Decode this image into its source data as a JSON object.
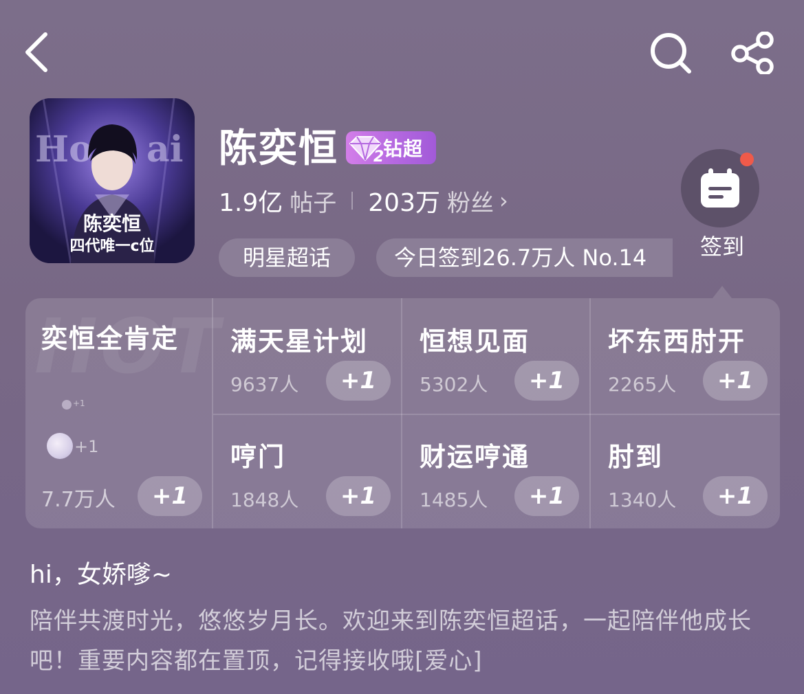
{
  "topbar": {
    "back_icon": "chevron-left-icon",
    "search_icon": "search-icon",
    "share_icon": "share-icon"
  },
  "profile": {
    "avatar_text_line1": "陈奕恒",
    "avatar_text_line2": "四代唯一c位",
    "name": "陈奕恒",
    "badge_text": "钻超",
    "badge_level": "2",
    "posts_num": "1.9亿",
    "posts_unit": "帖子",
    "fans_num": "203万",
    "fans_unit": "粉丝",
    "fans_chevron": "›",
    "tag_category": "明星超话",
    "tag_checkin": "今日签到26.7万人 No.14"
  },
  "checkin": {
    "label": "签到",
    "icon": "calendar-icon",
    "notification_color": "#ef5a4a"
  },
  "hot": {
    "watermark": "HOT",
    "featured": {
      "title": "奕恒全肯定",
      "count": "7.7万人",
      "plus": "+1",
      "mini_plus_small": "+1",
      "mini_plus": "+1"
    },
    "cells": [
      {
        "title": "满天星计划",
        "count": "9637人",
        "plus": "+1"
      },
      {
        "title": "恒想见面",
        "count": "5302人",
        "plus": "+1"
      },
      {
        "title": "坏东西肘开",
        "count": "2265人",
        "plus": "+1"
      },
      {
        "title": "哼门",
        "count": "1848人",
        "plus": "+1"
      },
      {
        "title": "财运哼通",
        "count": "1485人",
        "plus": "+1"
      },
      {
        "title": "肘到",
        "count": "1340人",
        "plus": "+1"
      }
    ]
  },
  "intro": {
    "greeting": "hi，女娇嗲~",
    "description": "陪伴共渡时光，悠悠岁月长。欢迎来到陈奕恒超话，一起陪伴他成长吧！重要内容都在置顶，记得接收哦[爱心]"
  },
  "colors": {
    "background": "#7a6b87",
    "badge": "#b468e0",
    "checkin_bg": "#5d5169"
  }
}
